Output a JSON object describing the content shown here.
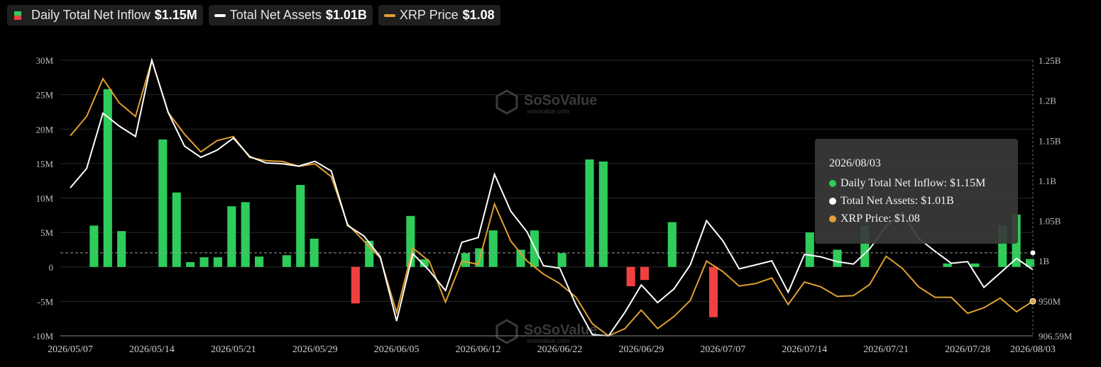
{
  "legend": [
    {
      "label": "Daily Total Net Inflow",
      "value": "$1.15M",
      "swatch": "bar"
    },
    {
      "label": "Total Net Assets",
      "value": "$1.01B",
      "swatch": "line",
      "color": "#ffffff"
    },
    {
      "label": "XRP Price",
      "value": "$1.08",
      "swatch": "line",
      "color": "#e0a030"
    }
  ],
  "colors": {
    "inflow_positive": "#2ecc5a",
    "inflow_negative": "#f04040",
    "assets": "#ffffff",
    "price": "#e0a030",
    "grid": "#2a2a2a"
  },
  "watermark": {
    "name": "SoSoValue",
    "url": "sosovalue.com"
  },
  "tooltip": {
    "date": "2026/08/03",
    "rows": [
      {
        "label": "Daily Total Net Inflow:",
        "value": "$1.15M",
        "color": "#2ecc5a"
      },
      {
        "label": "Total Net Assets:",
        "value": "$1.01B",
        "color": "#ffffff"
      },
      {
        "label": "XRP Price:",
        "value": "$1.08",
        "color": "#e0a030"
      }
    ]
  },
  "chart_data": {
    "type": "bar",
    "title": "",
    "xlabel": "",
    "ylabel": "",
    "x_tick_labels": [
      "2026/05/07",
      "2026/05/14",
      "2026/05/21",
      "2026/05/29",
      "2026/06/05",
      "2026/06/12",
      "2026/06/22",
      "2026/06/29",
      "2026/07/07",
      "2026/07/14",
      "2026/07/21",
      "2026/07/28",
      "2026/08/03"
    ],
    "x_tick_index": [
      0,
      5,
      10,
      15,
      20,
      25,
      30,
      35,
      40,
      45,
      50,
      55,
      59
    ],
    "y_left_ticks": [
      {
        "v": 30,
        "l": "30M"
      },
      {
        "v": 25,
        "l": "25M"
      },
      {
        "v": 20,
        "l": "20M"
      },
      {
        "v": 15,
        "l": "15M"
      },
      {
        "v": 10,
        "l": "10M"
      },
      {
        "v": 5,
        "l": "5M"
      },
      {
        "v": 0,
        "l": "0"
      },
      {
        "v": -5,
        "l": "-5M"
      },
      {
        "v": -10,
        "l": "-10M"
      }
    ],
    "ylim_left": [
      -10,
      30
    ],
    "y_right_ticks": [
      {
        "v": 1250,
        "l": "1.25B"
      },
      {
        "v": 1200,
        "l": "1.2B"
      },
      {
        "v": 1150,
        "l": "1.15B"
      },
      {
        "v": 1100,
        "l": "1.1B"
      },
      {
        "v": 1050,
        "l": "1.05B"
      },
      {
        "v": 1000,
        "l": "1B"
      },
      {
        "v": 950,
        "l": "950M"
      },
      {
        "v": 906.59,
        "l": "906.59M"
      }
    ],
    "ylim_right": [
      906.59,
      1250
    ],
    "series": [
      {
        "name": "Daily Total Net Inflow",
        "unit": "M USD",
        "type": "bar",
        "values": [
          0,
          6.0,
          25.8,
          5.2,
          0,
          0,
          18.5,
          10.8,
          0.7,
          1.4,
          1.4,
          8.8,
          9.4,
          1.5,
          0,
          1.7,
          11.9,
          4.1,
          0,
          0,
          -5.3,
          3.8,
          0,
          0,
          7.4,
          1.1,
          0,
          0,
          2.0,
          2.7,
          5.3,
          0,
          2.5,
          5.3,
          0,
          2.0,
          0,
          15.6,
          15.3,
          0,
          -2.8,
          -1.9,
          0,
          6.5,
          0,
          0,
          -7.3,
          0,
          0,
          0,
          0,
          0,
          0,
          5.0,
          0,
          2.5,
          0,
          6.0,
          0,
          0,
          0,
          0,
          0,
          0.5,
          0,
          0.5,
          0,
          6.0,
          7.6,
          1.15
        ]
      },
      {
        "name": "Total Net Assets",
        "unit": "M USD",
        "type": "line",
        "values": [
          1091,
          1115,
          1184,
          1168,
          1155,
          1250,
          1185,
          1143,
          1129,
          1138,
          1153,
          1130,
          1122,
          1121,
          1118,
          1124,
          1112,
          1044,
          1031,
          1005,
          925,
          1009,
          988,
          963,
          1023,
          1029,
          1108,
          1062,
          1036,
          994,
          991,
          945,
          908,
          906.59,
          936,
          970,
          948,
          965,
          995,
          1050,
          1025,
          990,
          995,
          1000,
          961,
          1008,
          1005,
          999,
          996,
          1015,
          1043,
          1060,
          1028,
          1012,
          997,
          999,
          967,
          985,
          1003,
          989
        ]
      },
      {
        "name": "XRP Price",
        "unit": "USD",
        "type": "line",
        "values": [
          1.156,
          1.18,
          1.227,
          1.197,
          1.18,
          1.25,
          1.185,
          1.158,
          1.136,
          1.15,
          1.155,
          1.129,
          1.125,
          1.124,
          1.118,
          1.121,
          1.105,
          1.046,
          1.025,
          1.004,
          936,
          1.016,
          1.0,
          949,
          1.0,
          996,
          1.071,
          1.025,
          1.0,
          984,
          972,
          955,
          922,
          907,
          916,
          939,
          916,
          931,
          951,
          1.0,
          987,
          969,
          972,
          979,
          946,
          974,
          968,
          956,
          957,
          971,
          1.006,
          991,
          968,
          955,
          955,
          935,
          942,
          954,
          937,
          950
        ]
      }
    ]
  }
}
